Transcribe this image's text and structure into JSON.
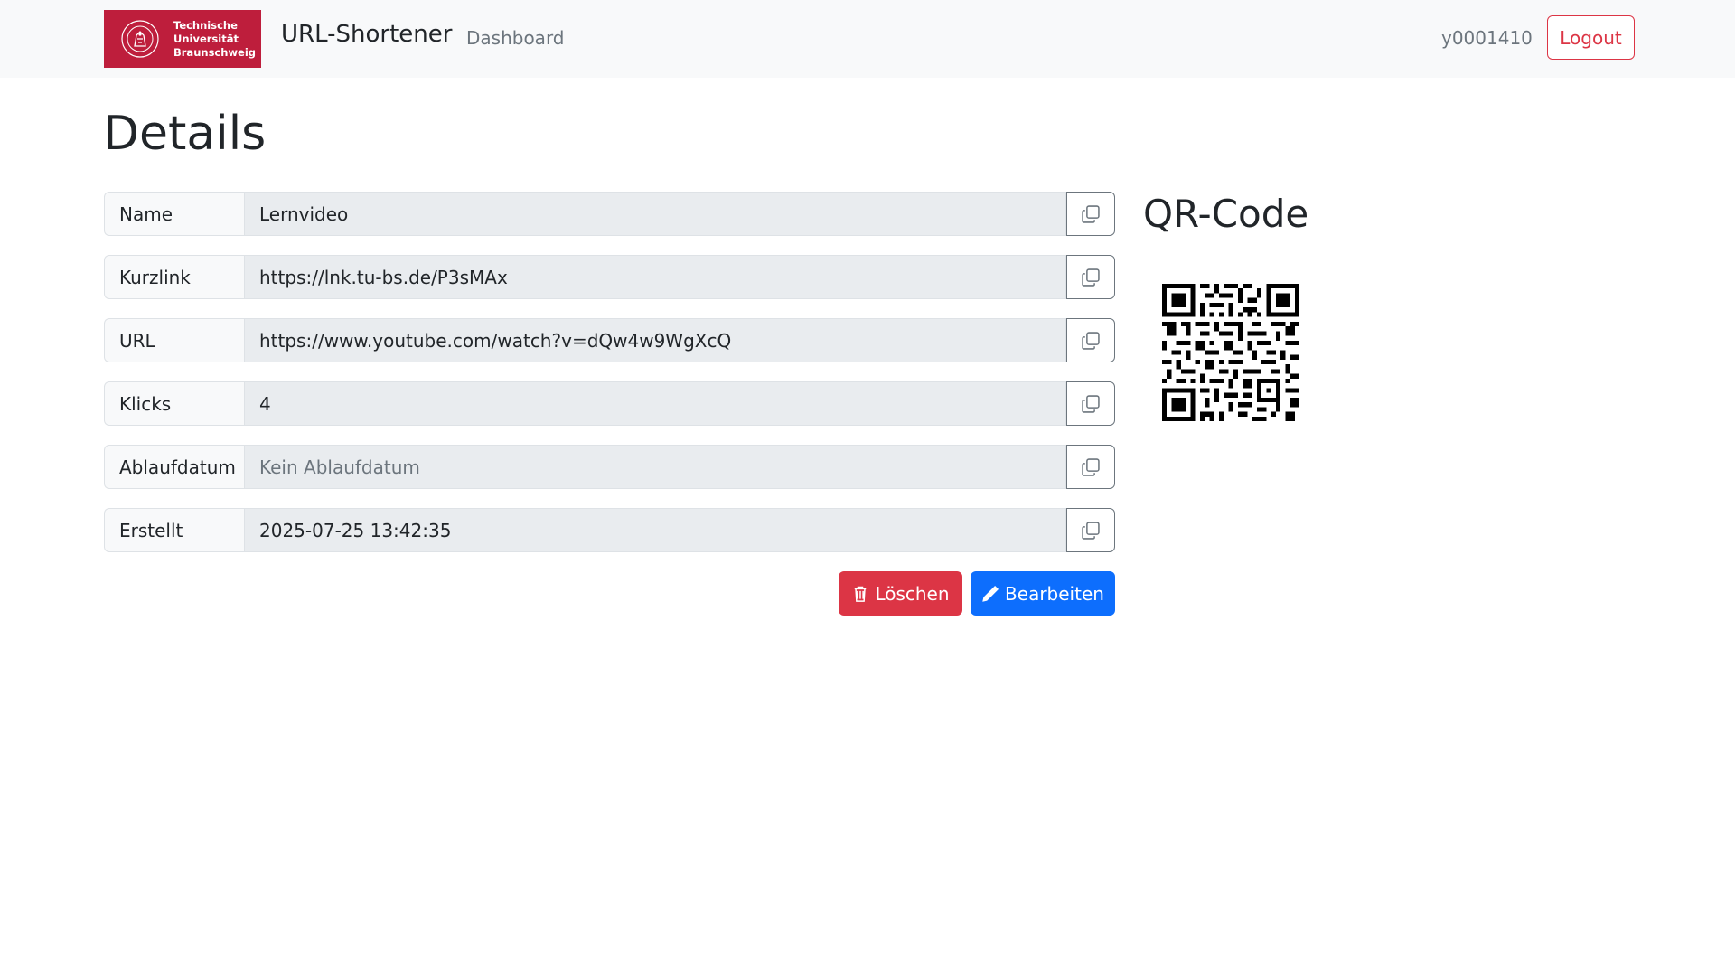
{
  "navbar": {
    "logo_lines": [
      "Technische",
      "Universität",
      "Braunschweig"
    ],
    "logo_color": "#be1e3c",
    "brand": "URL-Shortener",
    "nav_link": "Dashboard",
    "username": "y0001410",
    "logout_label": "Logout"
  },
  "page": {
    "title": "Details"
  },
  "details": [
    {
      "label": "Name",
      "value": "Lernvideo",
      "copy_icon": "copy-icon"
    },
    {
      "label": "Kurzlink",
      "value": "https://lnk.tu-bs.de/P3sMAx",
      "copy_icon": "copy-icon"
    },
    {
      "label": "URL",
      "value": "https://www.youtube.com/watch?v=dQw4w9WgXcQ",
      "copy_icon": "copy-icon"
    },
    {
      "label": "Klicks",
      "value": "4",
      "copy_icon": "copy-icon"
    },
    {
      "label": "Ablaufdatum",
      "placeholder": "Kein Ablaufdatum",
      "copy_icon": "copy-icon"
    },
    {
      "label": "Erstellt",
      "value": "2025-07-25 13:42:35",
      "copy_icon": "copy-icon"
    }
  ],
  "actions": {
    "delete_label": "Löschen",
    "delete_icon": "trash-icon",
    "delete_color": "#dc3545",
    "edit_label": "Bearbeiten",
    "edit_icon": "pencil-icon",
    "edit_color": "#0d6efd"
  },
  "qr": {
    "title": "QR-Code"
  }
}
